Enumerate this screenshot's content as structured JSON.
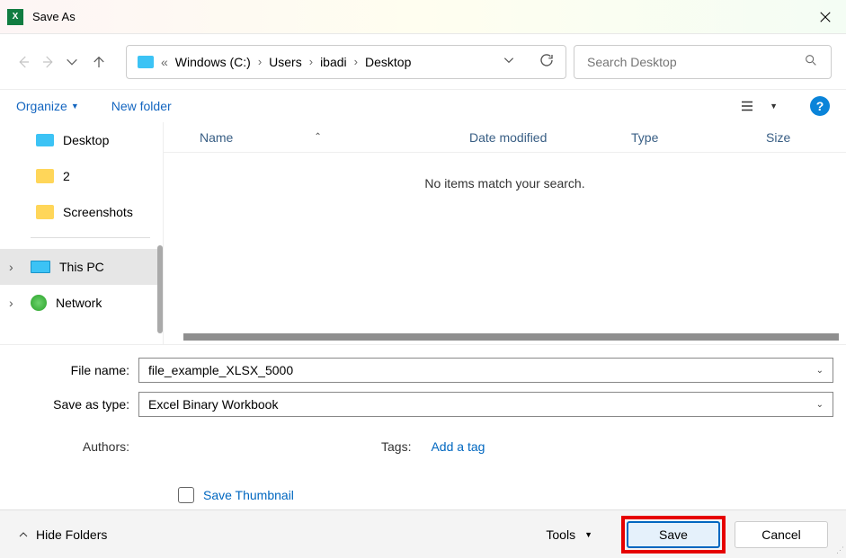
{
  "titlebar": {
    "title": "Save As"
  },
  "nav": {
    "breadcrumb": [
      "Windows (C:)",
      "Users",
      "ibadi",
      "Desktop"
    ],
    "search_placeholder": "Search Desktop"
  },
  "toolbar": {
    "organize": "Organize",
    "new_folder": "New folder"
  },
  "sidebar": {
    "items": [
      {
        "label": "Desktop",
        "icon": "desktop"
      },
      {
        "label": "2",
        "icon": "folder"
      },
      {
        "label": "Screenshots",
        "icon": "folder"
      }
    ],
    "roots": [
      {
        "label": "This PC",
        "icon": "pc",
        "selected": true
      },
      {
        "label": "Network",
        "icon": "net",
        "selected": false
      }
    ]
  },
  "content": {
    "columns": [
      "Name",
      "Date modified",
      "Type",
      "Size"
    ],
    "empty_message": "No items match your search."
  },
  "form": {
    "filename_label": "File name:",
    "filename_value": "file_example_XLSX_5000",
    "savetype_label": "Save as type:",
    "savetype_value": "Excel Binary Workbook",
    "authors_label": "Authors:",
    "tags_label": "Tags:",
    "tags_link": "Add a tag",
    "thumbnail_label": "Save Thumbnail"
  },
  "footer": {
    "hide_folders": "Hide Folders",
    "tools": "Tools",
    "save": "Save",
    "cancel": "Cancel"
  }
}
